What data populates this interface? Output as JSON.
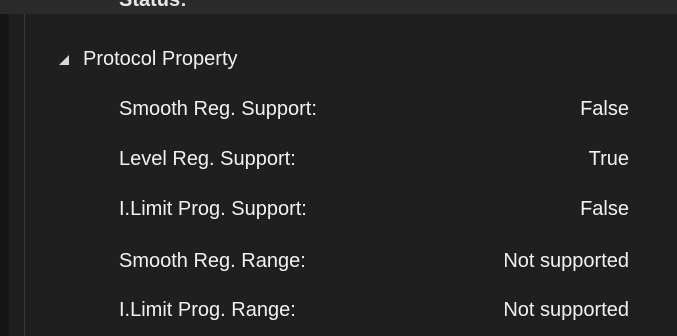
{
  "top_item": {
    "clipped_label": "Status:"
  },
  "group": {
    "title": "Protocol Property",
    "expanded": true,
    "icon": "triangle-down-icon"
  },
  "rows": [
    {
      "label": "Smooth Reg. Support:",
      "value": "False"
    },
    {
      "label": "Level Reg. Support:",
      "value": "True"
    },
    {
      "label": "I.Limit Prog. Support:",
      "value": "False"
    },
    {
      "label": "Smooth Reg. Range:",
      "value": "Not supported"
    },
    {
      "label": "I.Limit Prog. Range:",
      "value": "Not supported"
    }
  ]
}
